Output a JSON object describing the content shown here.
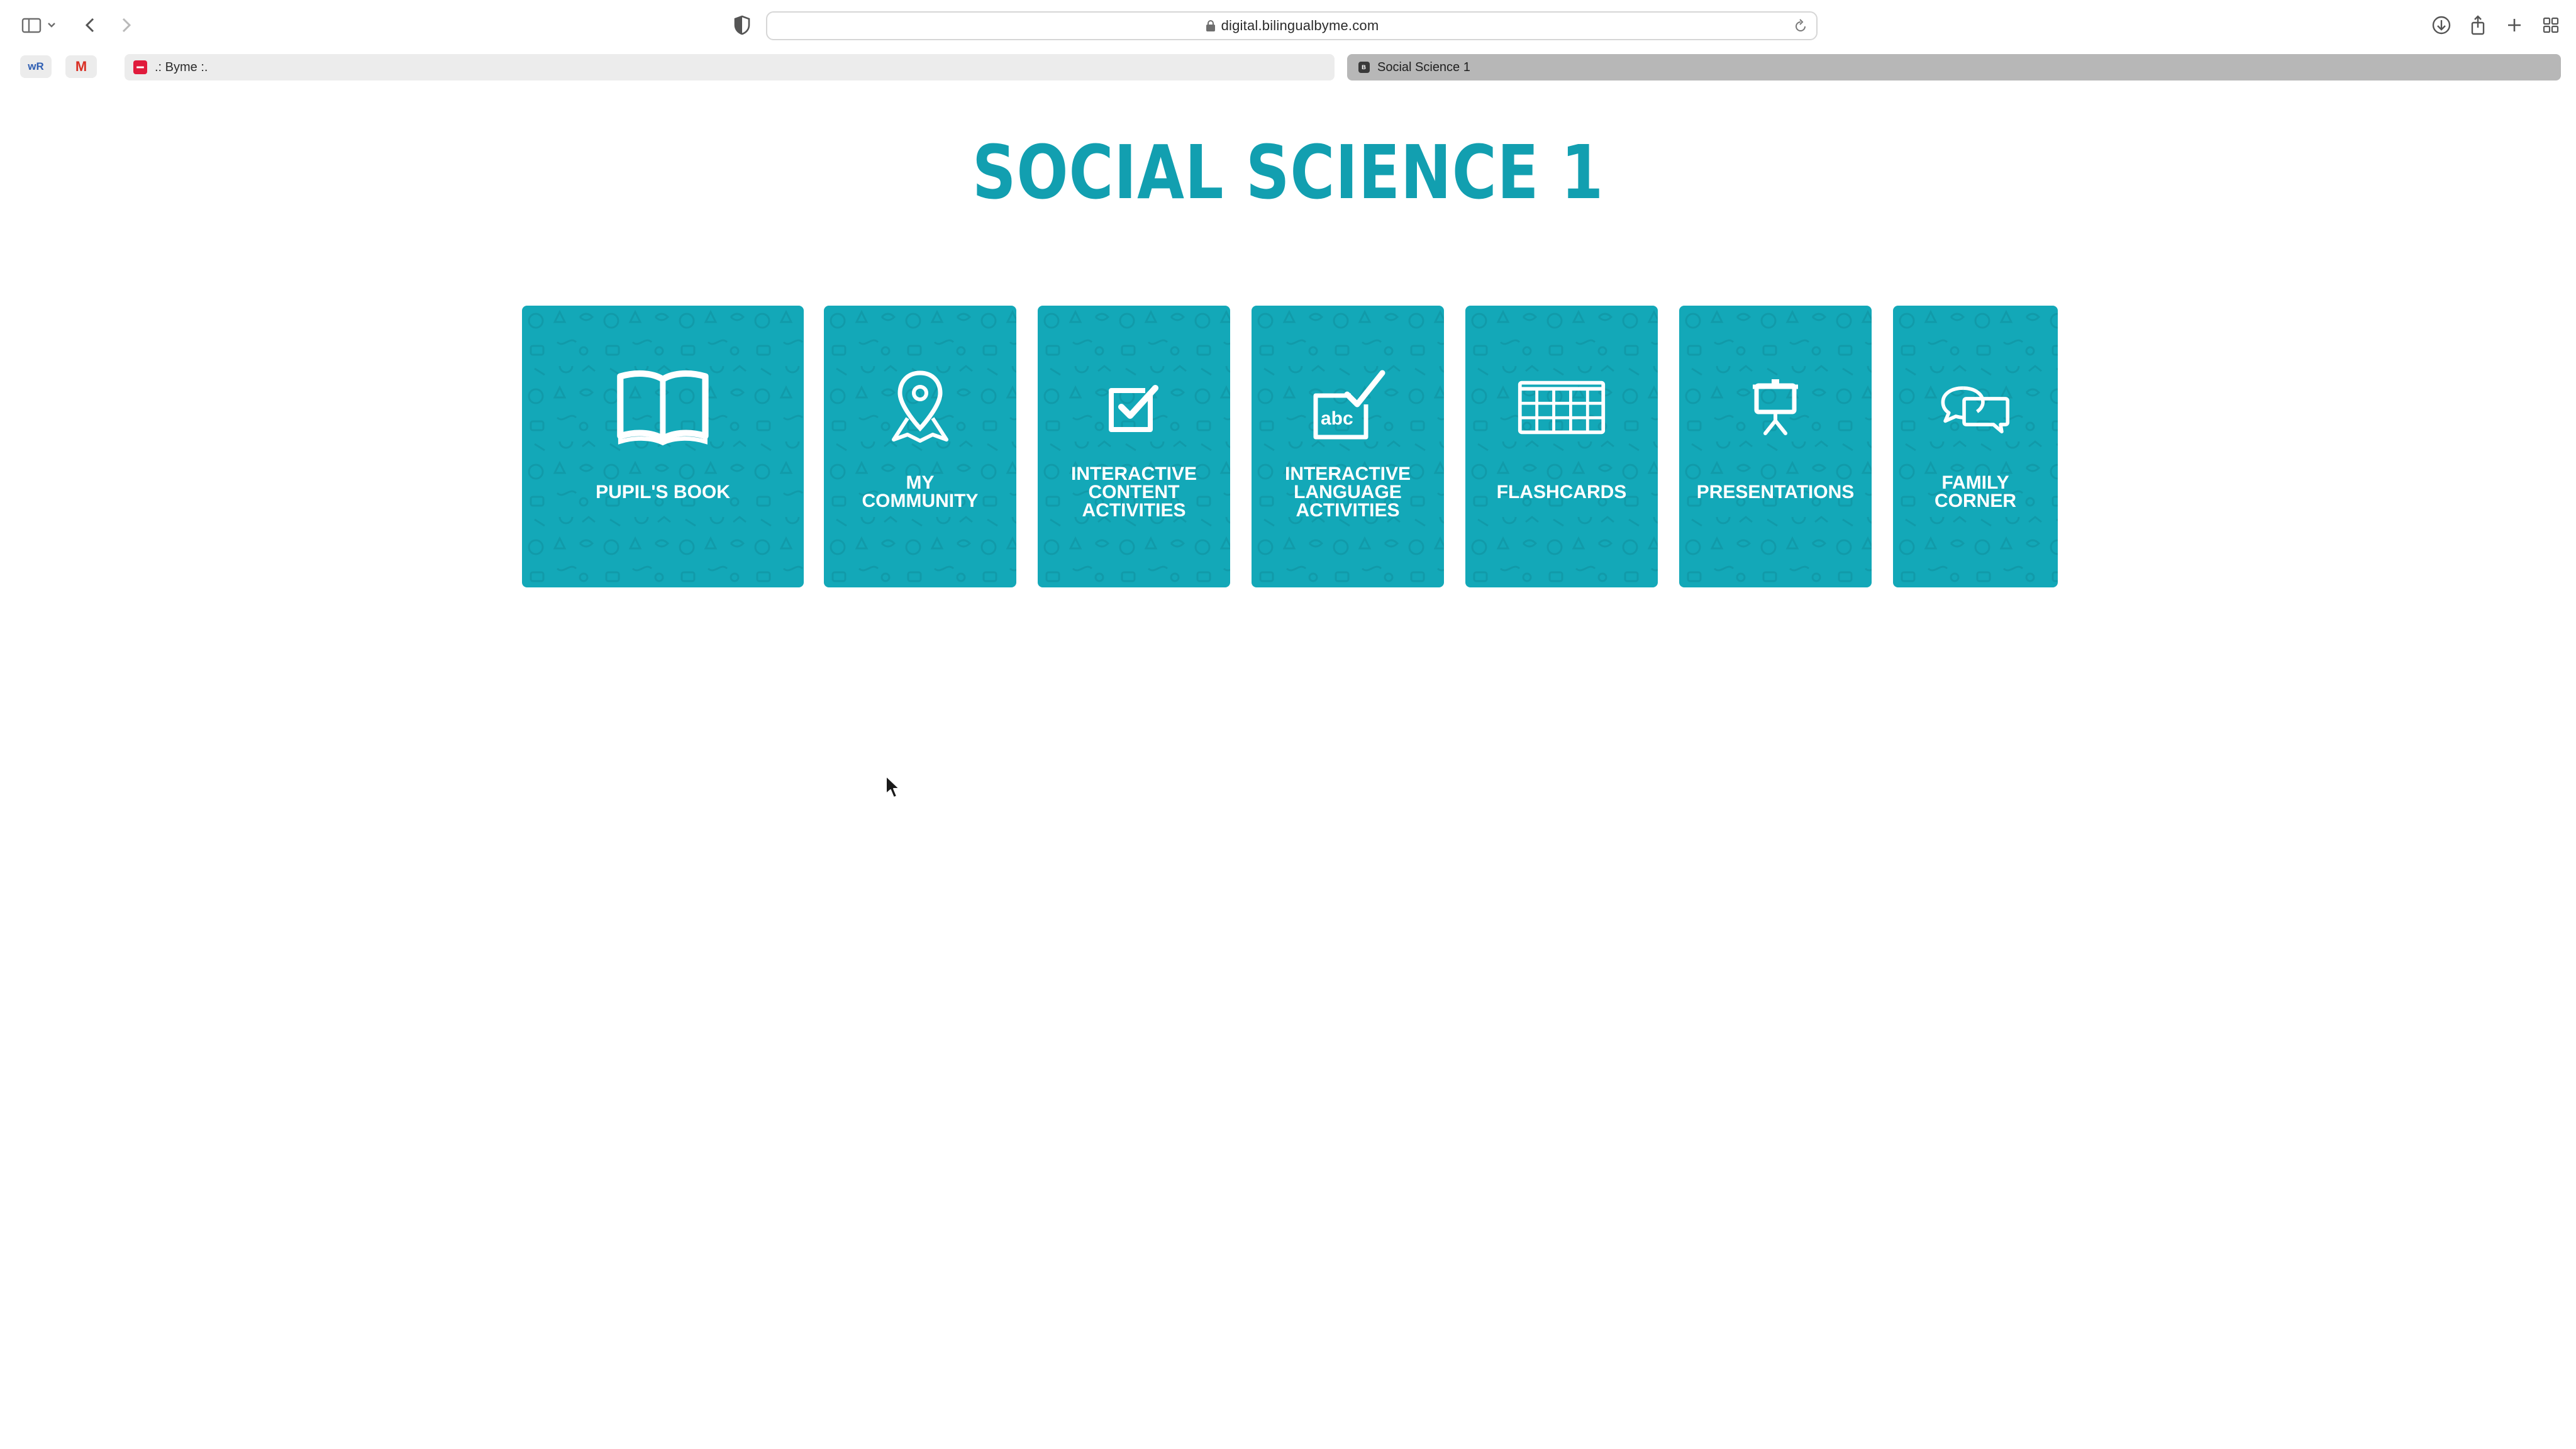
{
  "browser": {
    "url": "digital.bilingualbyme.com",
    "bookmarks": [
      {
        "label": "wR",
        "color": "#2f5fb3"
      },
      {
        "label": "M",
        "color": "#d93025"
      }
    ],
    "tabs": [
      {
        "title": ".: Byme :.",
        "active": false,
        "favicon_color": "#e01b3c"
      },
      {
        "title": "Social Science 1",
        "active": true,
        "favicon_color": "#3a3a3a"
      }
    ]
  },
  "page": {
    "title": "SOCIAL SCIENCE 1",
    "accent_color": "#13a8b8",
    "title_color": "#129fb0",
    "tiles": [
      {
        "label": "PUPIL'S BOOK",
        "icon": "book-icon"
      },
      {
        "label": "MY\nCOMMUNITY",
        "icon": "map-pin-icon"
      },
      {
        "label": "INTERACTIVE\nCONTENT\nACTIVITIES",
        "icon": "checkbox-icon"
      },
      {
        "label": "INTERACTIVE\nLANGUAGE\nACTIVITIES",
        "icon": "abc-check-icon"
      },
      {
        "label": "FLASHCARDS",
        "icon": "cards-grid-icon"
      },
      {
        "label": "PRESENTATIONS",
        "icon": "easel-icon"
      },
      {
        "label": "FAMILY\nCORNER",
        "icon": "speech-bubbles-icon"
      }
    ]
  }
}
